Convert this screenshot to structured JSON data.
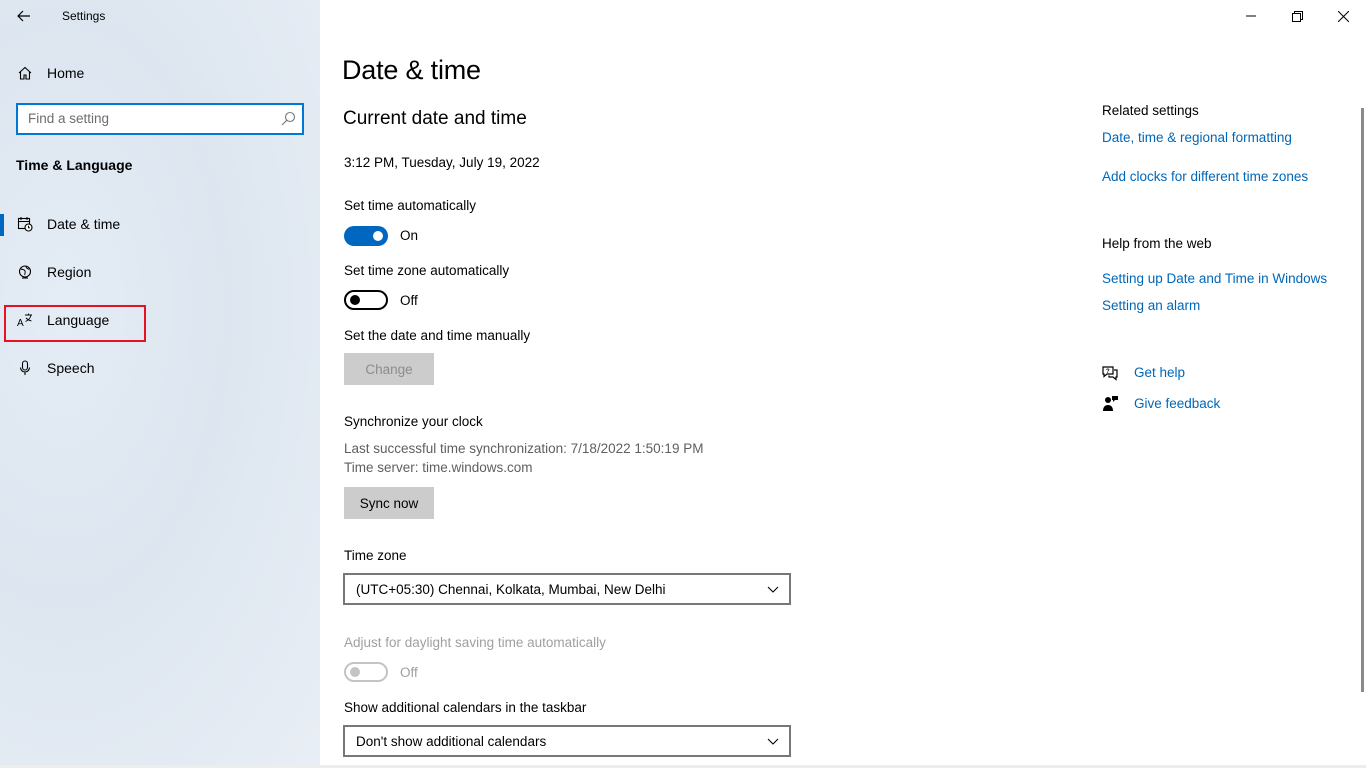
{
  "window": {
    "app_title": "Settings",
    "controls": {
      "minimize": "minimize-icon",
      "restore": "restore-icon",
      "close": "close-icon"
    }
  },
  "sidebar": {
    "home_label": "Home",
    "search_placeholder": "Find a setting",
    "section_title": "Time & Language",
    "items": [
      {
        "label": "Date & time",
        "icon": "calendar-clock-icon",
        "active": true
      },
      {
        "label": "Region",
        "icon": "globe-icon",
        "active": false
      },
      {
        "label": "Language",
        "icon": "language-icon",
        "active": false,
        "highlighted": true
      },
      {
        "label": "Speech",
        "icon": "microphone-icon",
        "active": false
      }
    ]
  },
  "main": {
    "page_title": "Date & time",
    "section_title": "Current date and time",
    "current_datetime": "3:12 PM, Tuesday, July 19, 2022",
    "set_time_auto": {
      "label": "Set time automatically",
      "state": "On"
    },
    "set_timezone_auto": {
      "label": "Set time zone automatically",
      "state": "Off"
    },
    "manual": {
      "label": "Set the date and time manually",
      "button": "Change"
    },
    "sync": {
      "title": "Synchronize your clock",
      "last_sync": "Last successful time synchronization: 7/18/2022 1:50:19 PM",
      "server": "Time server: time.windows.com",
      "button": "Sync now"
    },
    "timezone": {
      "label": "Time zone",
      "value": "(UTC+05:30) Chennai, Kolkata, Mumbai, New Delhi"
    },
    "dst": {
      "label": "Adjust for daylight saving time automatically",
      "state": "Off"
    },
    "calendars": {
      "label": "Show additional calendars in the taskbar",
      "value": "Don't show additional calendars"
    }
  },
  "right": {
    "related_title": "Related settings",
    "related_links": [
      "Date, time & regional formatting",
      "Add clocks for different time zones"
    ],
    "help_title": "Help from the web",
    "help_links": [
      "Setting up Date and Time in Windows",
      "Setting an alarm"
    ],
    "get_help": "Get help",
    "give_feedback": "Give feedback"
  },
  "colors": {
    "accent": "#0067c0",
    "link": "#0067b8",
    "highlight_box": "#e81123"
  }
}
